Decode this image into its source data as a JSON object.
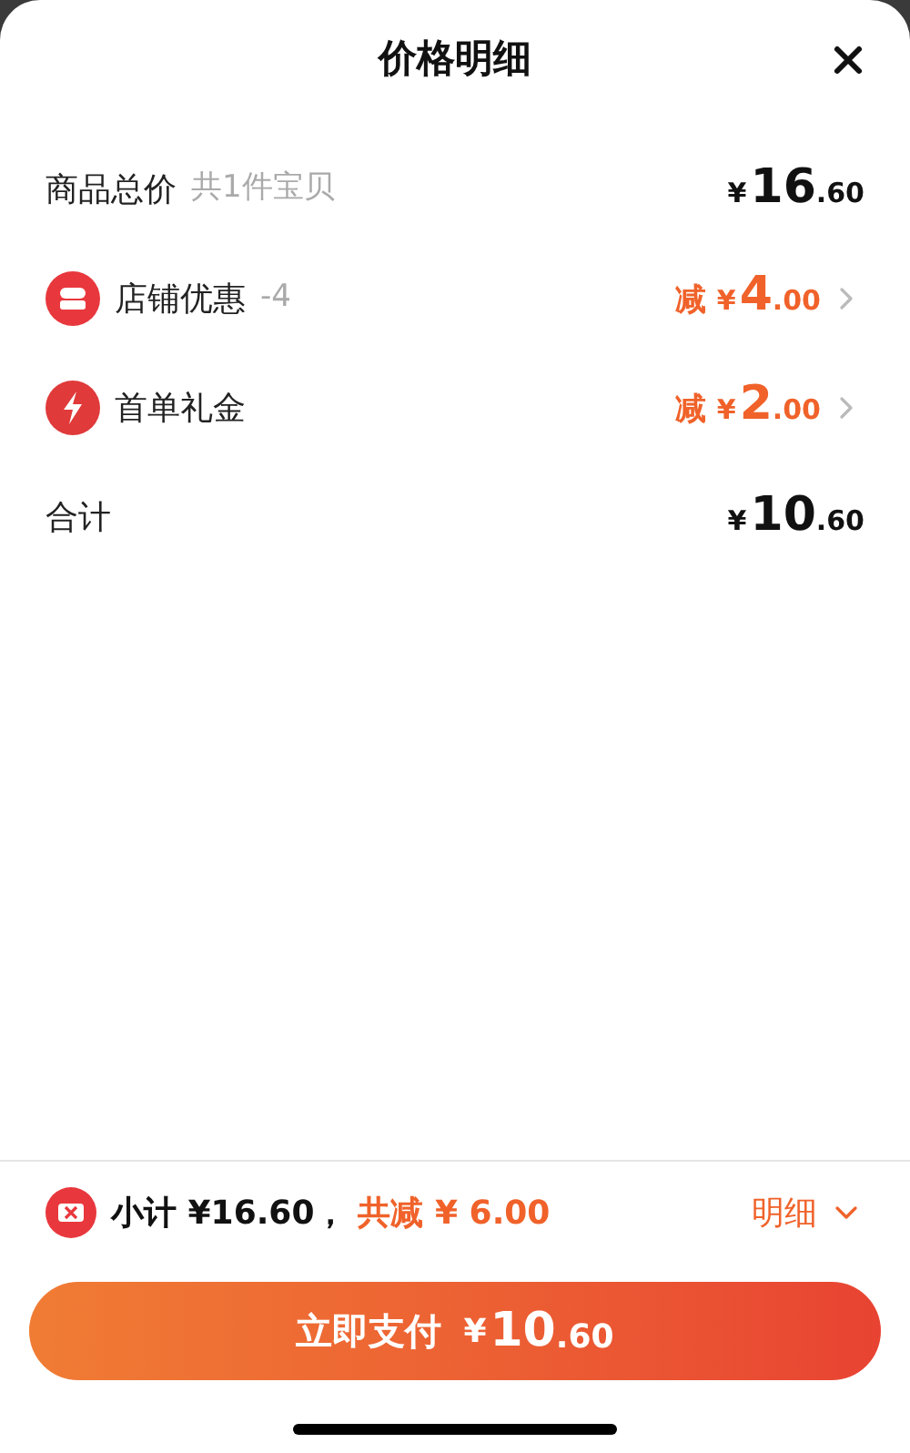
{
  "sheet": {
    "title": "价格明细"
  },
  "rows": [
    {
      "kind": "plain",
      "label": "商品总价",
      "note": "共1件宝贝",
      "price": {
        "symbol": "¥",
        "integer": "16",
        "decimal": ".60"
      }
    },
    {
      "kind": "shop",
      "label": "店铺优惠",
      "note": "-4",
      "prefix": "减",
      "price": {
        "symbol": "¥",
        "integer": "4",
        "decimal": ".00"
      }
    },
    {
      "kind": "bolt",
      "label": "首单礼金",
      "prefix": "减",
      "price": {
        "symbol": "¥",
        "integer": "2",
        "decimal": ".00"
      }
    },
    {
      "kind": "plain",
      "label": "合计",
      "price": {
        "symbol": "¥",
        "integer": "10",
        "decimal": ".60"
      }
    }
  ],
  "footer": {
    "subtotal": "小计 ¥16.60，",
    "saved": "共减 ¥ 6.00",
    "details_link": "明细"
  },
  "pay_button": {
    "label": "立即支付",
    "symbol": "¥",
    "integer": "10",
    "decimal": ".60"
  }
}
